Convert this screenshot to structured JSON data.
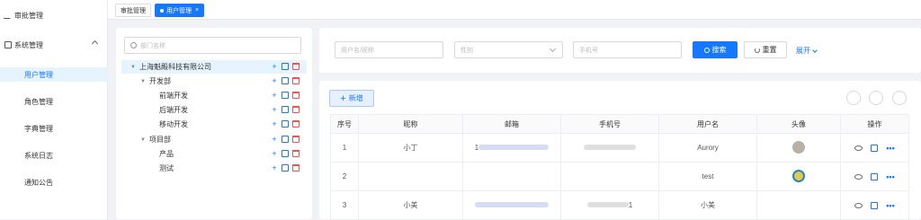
{
  "sidebar": {
    "items": [
      {
        "label": "审批管理",
        "icon": "edit-icon"
      },
      {
        "label": "系统管理",
        "icon": "monitor-icon"
      },
      {
        "label": "用户管理"
      },
      {
        "label": "角色管理"
      },
      {
        "label": "字典管理"
      },
      {
        "label": "系统日志"
      },
      {
        "label": "通知公告"
      }
    ]
  },
  "tabs": [
    {
      "label": "审批管理"
    },
    {
      "label": "用户管理",
      "close": "×"
    }
  ],
  "dept": {
    "placeholder": "部门名称",
    "nodes": [
      {
        "label": "上海魁殿科技有限公司"
      },
      {
        "label": "开发部"
      },
      {
        "label": "前端开发"
      },
      {
        "label": "后端开发"
      },
      {
        "label": "移动开发"
      },
      {
        "label": "项目部"
      },
      {
        "label": "产品"
      },
      {
        "label": "测试"
      }
    ]
  },
  "search": {
    "username_placeholder": "用户名/昵称",
    "gender_placeholder": "性别",
    "phone_placeholder": "手机号",
    "search_label": "搜索",
    "reset_label": "重置",
    "expand_label": "展开"
  },
  "toolbar": {
    "add_label": "新增"
  },
  "table": {
    "headers": [
      "序号",
      "昵称",
      "邮箱",
      "手机号",
      "用户名",
      "头像",
      "操作"
    ],
    "rows": [
      {
        "index": "1",
        "nickname": "小丁",
        "username": "Aurory",
        "email_prefix": "1"
      },
      {
        "index": "2",
        "nickname": "",
        "username": "test"
      },
      {
        "index": "3",
        "nickname": "小美",
        "username": "小美",
        "phone_suffix": "1"
      }
    ]
  },
  "colors": {
    "accent": "#1677ff",
    "danger": "#ff4d4f"
  }
}
